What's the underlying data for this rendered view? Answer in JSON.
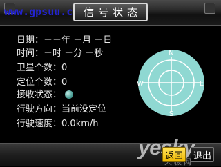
{
  "header": {
    "title": "信号状态",
    "watermark": "www.gpsuu.com"
  },
  "info": {
    "date": {
      "label": "日期：",
      "value": "－－年 －月 －日"
    },
    "time": {
      "label": "时间：",
      "value": "－时 －分 －秒"
    },
    "satellites": {
      "label": "卫星个数：",
      "value": "0"
    },
    "positioned": {
      "label": "定位个数：",
      "value": "0"
    },
    "receive_status": {
      "label": "接收状态："
    },
    "heading": {
      "label": "行驶方向：",
      "value": "当前没定位"
    },
    "speed": {
      "label": "行驶速度：",
      "value": "0.0km/h"
    }
  },
  "radar": {
    "north": "N",
    "south": "S",
    "east": "E",
    "west": "W",
    "fill_color": "#8fd8d2",
    "line_color": "#ffffff"
  },
  "footer": {
    "back_label": "返回",
    "exit_label": "退出",
    "watermark": "yesky",
    "watermark_sub": "天极网",
    "back_color": "#f0b800"
  }
}
